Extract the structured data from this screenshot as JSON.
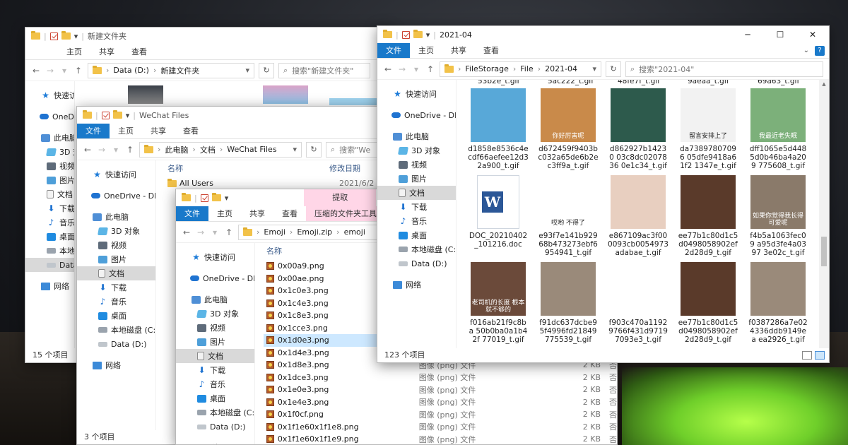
{
  "win1": {
    "title": "新建文件夹",
    "tabs": [
      "主页",
      "共享",
      "查看"
    ],
    "address": [
      "Data (D:)",
      "新建文件夹"
    ],
    "search_placeholder": "搜索\"新建文件夹\"",
    "nav": [
      "快速访问",
      "OneDrive",
      "此电脑",
      "3D 对象",
      "视频",
      "图片",
      "文档",
      "下载",
      "音乐",
      "桌面",
      "本地磁盘",
      "Data (D:)",
      "网络"
    ],
    "status": "15 个项目"
  },
  "win2": {
    "title": "WeChat Files",
    "tabs": [
      "文件",
      "主页",
      "共享",
      "查看"
    ],
    "address": [
      "此电脑",
      "文档",
      "WeChat Files"
    ],
    "search_placeholder": "搜索\"We",
    "nav": [
      "快速访问",
      "OneDrive - DIGI",
      "此电脑",
      "3D 对象",
      "视频",
      "图片",
      "文档",
      "下载",
      "音乐",
      "桌面",
      "本地磁盘 (C:)",
      "Data (D:)",
      "网络"
    ],
    "col_name": "名称",
    "col_date": "修改日期",
    "row_name": "All Users",
    "row_date": "2021/6/2",
    "status": "3 个项目"
  },
  "win3": {
    "title_hl": "提取",
    "tabs": [
      "文件",
      "主页",
      "共享",
      "查看"
    ],
    "tab_tool": "压缩的文件夹工具",
    "address": [
      "Emoji",
      "Emoji.zip",
      "emoji"
    ],
    "nav": [
      "快速访问",
      "OneDrive - DIGI",
      "此电脑",
      "3D 对象",
      "视频",
      "图片",
      "文档",
      "下载",
      "音乐",
      "桌面",
      "本地磁盘 (C:)",
      "Data (D:)",
      "网络"
    ],
    "col_name": "名称",
    "files": [
      {
        "name": "0x00a9.png"
      },
      {
        "name": "0x00ae.png"
      },
      {
        "name": "0x1c0e3.png"
      },
      {
        "name": "0x1c4e3.png"
      },
      {
        "name": "0x1c8e3.png"
      },
      {
        "name": "0x1cce3.png"
      },
      {
        "name": "0x1d0e3.png"
      },
      {
        "name": "0x1d4e3.png"
      },
      {
        "name": "0x1d8e3.png"
      },
      {
        "name": "0x1dce3.png",
        "type": "图像 (png) 文件",
        "size": "2 KB",
        "comp": "否"
      },
      {
        "name": "0x1e0e3.png",
        "type": "图像 (png) 文件",
        "size": "2 KB",
        "comp": "否"
      },
      {
        "name": "0x1e4e3.png",
        "type": "图像 (png) 文件",
        "size": "2 KB",
        "comp": "否"
      },
      {
        "name": "0x1f0cf.png",
        "type": "图像 (png) 文件",
        "size": "2 KB",
        "comp": "否"
      },
      {
        "name": "0x1f1e60x1f1e8.png",
        "type": "图像 (png) 文件",
        "size": "2 KB",
        "comp": "否"
      },
      {
        "name": "0x1f1e60x1f1e9.png",
        "type": "图像 (png) 文件",
        "size": "2 KB",
        "comp": "否"
      }
    ],
    "row8": {
      "type": "图像 (png) 文件",
      "size": "2 KB",
      "comp": "否"
    }
  },
  "win4": {
    "title": "2021-04",
    "tabs": [
      "文件",
      "主页",
      "共享",
      "查看"
    ],
    "address": [
      "FileStorage",
      "File",
      "2021-04"
    ],
    "search_placeholder": "搜索\"2021-04\"",
    "nav": [
      "快速访问",
      "OneDrive - DIGI",
      "此电脑",
      "3D 对象",
      "视频",
      "图片",
      "文档",
      "下载",
      "音乐",
      "桌面",
      "本地磁盘 (C:)",
      "Data (D:)",
      "网络"
    ],
    "top_caps": [
      "53b2e_t.gif",
      "5ac222_t.gif",
      "48fe7f_t.gif",
      "9aeaa_t.gif",
      "69a63_t.gif"
    ],
    "thumbs": [
      {
        "cap": "d1858e8536c4e cdf66aefee12d3 2a900_t.gif",
        "color": "#58a8d8",
        "label": ""
      },
      {
        "cap": "d672459f9403b c032a65de6b2e c3ff9a_t.gif",
        "color": "#c98a4a",
        "label": "你好厉害呢"
      },
      {
        "cap": "d862927b14230 03c8dc0207836 0e1c34_t.gif",
        "color": "#2d5a4c",
        "label": ""
      },
      {
        "cap": "da73897807096 05dfe9418a61f2 1347e_t.gif",
        "color": "#f2f2f2",
        "label": "留言安排上了"
      },
      {
        "cap": "dff1065e5d448 5d0b46ba4a209 775608_t.gif",
        "color": "#7cb07a",
        "label": "我最近老失眠"
      },
      {
        "cap": "DOC_20210402 _101216.doc",
        "color": "#ffffff",
        "label": "W"
      },
      {
        "cap": "e93f7e141b929 68b473273ebf6 954941_t.gif",
        "color": "#ffffff",
        "label": "哎哟 不得了"
      },
      {
        "cap": "e867109ac3f00 0093cb0054973 adabae_t.gif",
        "color": "#e8cfc0",
        "label": ""
      },
      {
        "cap": "ee77b1c80d1c5 d0498058902ef 2d28d9_t.gif",
        "color": "#5a3a2a",
        "label": ""
      },
      {
        "cap": "f4b5a1063fec09 a95d3fe4a0397 3e02c_t.gif",
        "color": "#8a7a6a",
        "label": "如果你觉得我长得可爱呢"
      },
      {
        "cap": "f016ab21f9c8ba 50b0ba0a1b42f 77019_t.gif",
        "color": "#6b4a3a",
        "label": "老司机的长度 根本就不够的"
      },
      {
        "cap": "f91dc637dcbe9 5f4996fd21849 775539_t.gif",
        "color": "#9a8a7a",
        "label": ""
      },
      {
        "cap": "f903c470a1192 9766f431d9719 7093e3_t.gif",
        "color": "#ffffff",
        "label": ""
      },
      {
        "cap": "ee77b1c80d1c5 d0498058902ef 2d28d9_t.gif",
        "color": "#5a3a2a",
        "label": ""
      },
      {
        "cap": "f0387286a7e02 4336ddb9149ea ea2926_t.gif",
        "color": "#9a8a7a",
        "label": ""
      }
    ],
    "status": "123 个项目"
  }
}
